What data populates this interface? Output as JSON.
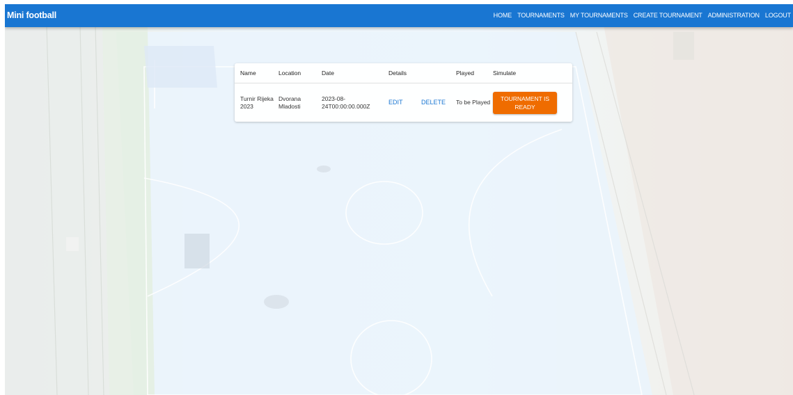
{
  "app": {
    "title": "Mini football"
  },
  "nav": {
    "items": [
      {
        "id": "home",
        "label": "HOME"
      },
      {
        "id": "tournaments",
        "label": "TOURNAMENTS"
      },
      {
        "id": "my-tournaments",
        "label": "MY TOURNAMENTS"
      },
      {
        "id": "create-tournament",
        "label": "CREATE TOURNAMENT"
      },
      {
        "id": "administration",
        "label": "ADMINISTRATION"
      },
      {
        "id": "logout",
        "label": "LOGOUT"
      }
    ]
  },
  "table": {
    "headers": {
      "name": "Name",
      "location": "Location",
      "date": "Date",
      "details": "Details",
      "played": "Played",
      "simulate": "Simulate"
    },
    "rows": [
      {
        "name": "Turnir Rijeka 2023",
        "location": "Dvorana Mladosti",
        "date": "2023-08-24T00:00:00.000Z",
        "edit_label": "EDIT",
        "delete_label": "DELETE",
        "played": "To be Played",
        "simulate_label": "TOURNAMENT IS READY"
      }
    ]
  },
  "colors": {
    "appbar": "#1976d2",
    "link": "#1976d2",
    "played_status": "#ed9a47",
    "simulate_button": "#ef6c00"
  }
}
